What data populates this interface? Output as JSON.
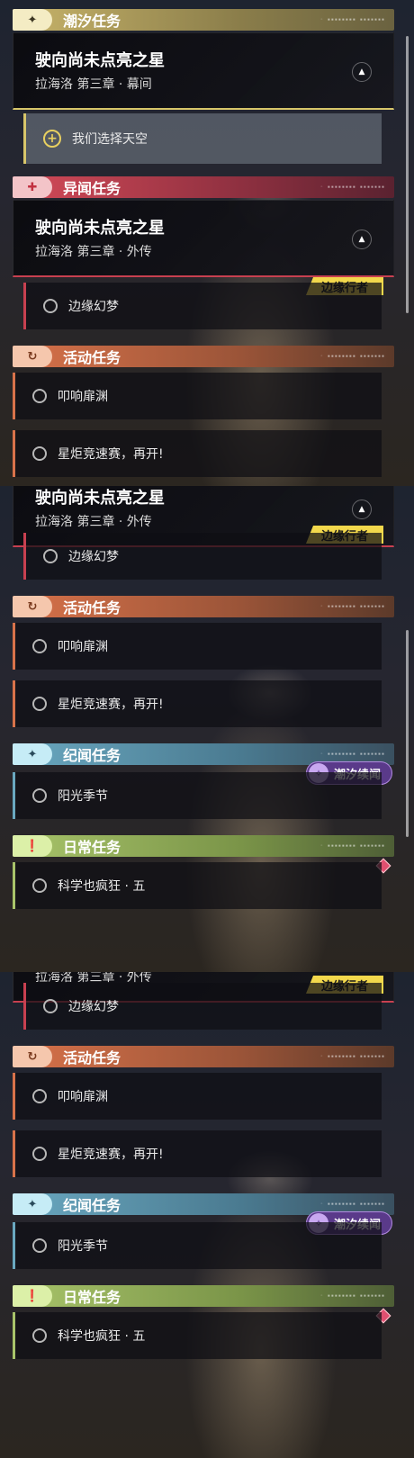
{
  "categories": {
    "tide": {
      "label": "潮汐任务",
      "icon": "sparkle-icon",
      "color": "#d8c66a"
    },
    "strange": {
      "label": "异闻任务",
      "icon": "anomaly-icon",
      "color": "#c84050"
    },
    "event": {
      "label": "活动任务",
      "icon": "cycle-icon",
      "color": "#d8724a"
    },
    "lore": {
      "label": "纪闻任务",
      "icon": "sparkle-icon",
      "color": "#6aa8c0"
    },
    "daily": {
      "label": "日常任务",
      "icon": "alert-icon",
      "color": "#a8c46a"
    }
  },
  "tide_card": {
    "title": "驶向尚未点亮之星",
    "subtitle": "拉海洛 第三章 · 幕间"
  },
  "strange_card": {
    "title": "驶向尚未点亮之星",
    "subtitle": "拉海洛 第三章 · 外传"
  },
  "quests": {
    "tide_selected": "我们选择天空",
    "edge_dream": "边缘幻梦",
    "abyss": "叩响扉渊",
    "race": "星炬竞速赛，再开!",
    "sunlight": "阳光季节",
    "science": "科学也疯狂 · 五"
  },
  "badges": {
    "edge_walker": "边缘行者",
    "tide_lore": "潮汐续闻"
  },
  "header_deco": "◦ ▪▪▪▪▪▪▪▪  ▪▪▪▪▪▪▪"
}
